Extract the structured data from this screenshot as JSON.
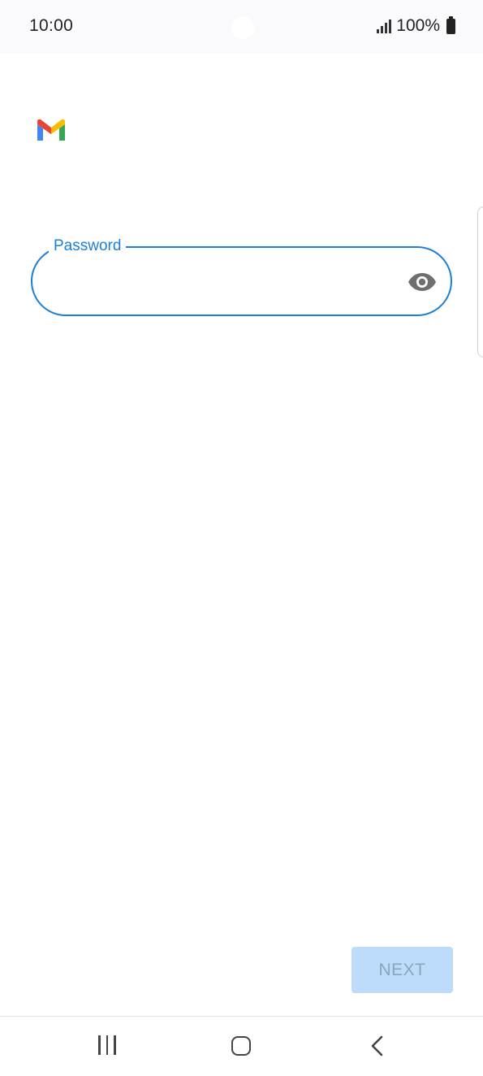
{
  "status_bar": {
    "time": "10:00",
    "battery_text": "100%",
    "signal_icon": "signal-bars-icon",
    "battery_icon": "battery-full-icon"
  },
  "app": {
    "logo_icon": "gmail-logo-icon",
    "colors": {
      "gmail_blue": "#4285F4",
      "gmail_red": "#EA4335",
      "gmail_yellow": "#FBBC04",
      "gmail_green": "#34A853"
    }
  },
  "form": {
    "password_label": "Password",
    "password_value": "",
    "password_icon": "eye-visibility-icon",
    "field_color": "#1b7fd6"
  },
  "actions": {
    "next_label": "NEXT",
    "next_enabled": false,
    "next_bg": "#bcdcf9"
  },
  "nav_bar": {
    "recents_icon": "recents-icon",
    "home_icon": "home-icon",
    "back_icon": "back-icon"
  }
}
